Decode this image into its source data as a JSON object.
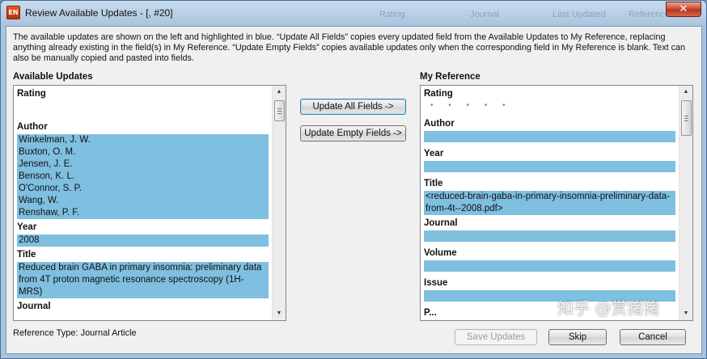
{
  "window": {
    "title": "Review Available Updates - [,  #20]",
    "app_icon_text": "EN",
    "close_glyph": "✕",
    "background_tabs": [
      "Rating",
      "Journal",
      "Last Updated",
      "Reference"
    ]
  },
  "description": "The available updates are shown on the left and highlighted in blue. “Update All Fields” copies every updated field from the Available Updates to My Reference, replacing anything already existing in the field(s) in My Reference. “Update Empty Fields” copies available updates only when the corresponding field in My Reference is blank. Text can also be manually copied and pasted into fields.",
  "available": {
    "title": "Available Updates",
    "rating_label": "Rating",
    "author_label": "Author",
    "authors": [
      "Winkelman, J. W.",
      "Buxton, O. M.",
      "Jensen, J. E.",
      "Benson, K. L.",
      "O'Connor, S. P.",
      "Wang, W.",
      "Renshaw, P. F."
    ],
    "year_label": "Year",
    "year_value": "2008",
    "title_label": "Title",
    "title_value": "Reduced brain GABA in primary insomnia: preliminary data from 4T proton magnetic resonance spectroscopy (1H-MRS)",
    "journal_label": "Journal"
  },
  "reference": {
    "title": "My Reference",
    "rating_label": "Rating",
    "rating_dots": "• • • • •",
    "author_label": "Author",
    "year_label": "Year",
    "title_label": "Title",
    "title_value": "<reduced-brain-gaba-in-primary-insomnia-preliminary-data-from-4t--2008.pdf>",
    "journal_label": "Journal",
    "volume_label": "Volume",
    "issue_label": "Issue",
    "next_label": "P..."
  },
  "buttons": {
    "update_all": "Update All Fields ->",
    "update_empty": "Update Empty Fields ->",
    "save": "Save Updates",
    "skip": "Skip",
    "cancel": "Cancel"
  },
  "reference_type": "Reference Type: Journal Article",
  "watermark": "知乎 @赏猪猪",
  "colors": {
    "highlight": "#7fbfe0",
    "titlebar": "#b4cde5",
    "close": "#c8462d"
  },
  "icons": {
    "scroll_up": "▲",
    "scroll_down": "▼"
  }
}
